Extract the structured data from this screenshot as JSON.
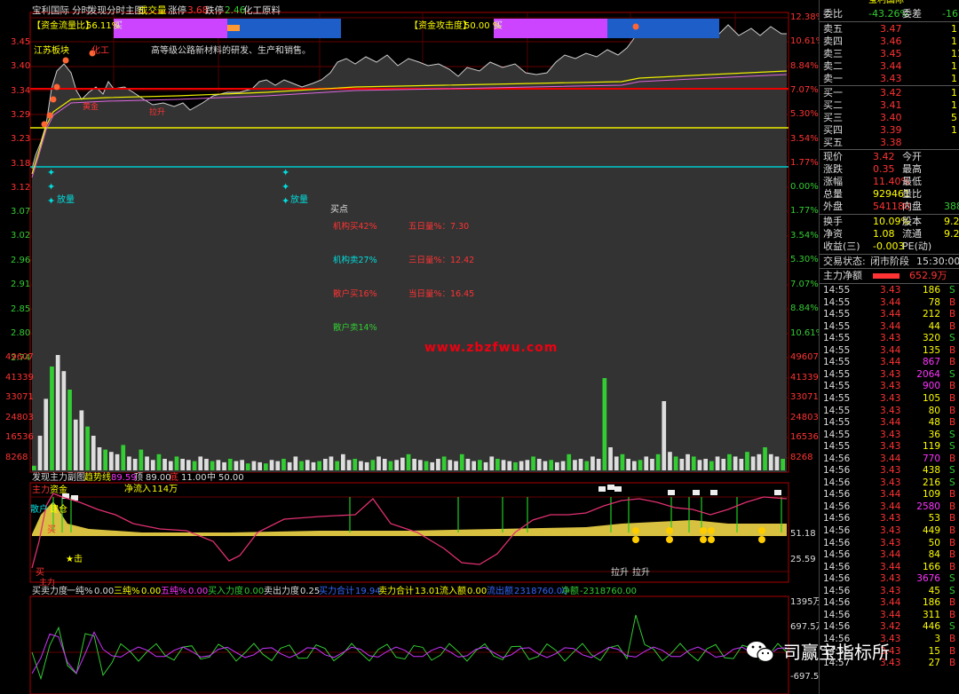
{
  "header": {
    "stock_name": "宝利国际",
    "mode": "分时",
    "indicator": "发现分时主图",
    "volume_label": "成交量",
    "limit_up_label": "涨停",
    "limit_up_value": "3.68",
    "limit_down_label": "跌停",
    "limit_down_value": "2.46",
    "sector": "化工原料"
  },
  "flow_bars": {
    "left_label": "【资金流量比】",
    "left_value": "56.11%",
    "left_tag": "买",
    "right_label": "【资金攻击度】",
    "right_value": "50.00 %",
    "right_tag": "买"
  },
  "annotations": {
    "region": "江苏板块",
    "sector_tag": "化工",
    "business": "高等级公路新材料的研发、生产和销售。",
    "volume_up_1": "放量",
    "volume_up_2": "放量",
    "buy_point": "买点",
    "inst_buy": "机构买42%",
    "inst_sell": "机构卖27%",
    "retail_buy": "散户买16%",
    "retail_sell": "散户卖14%",
    "five_day_vol": "五日量%：7.30",
    "three_day_vol": "三日量%：12.42",
    "today_vol": "当日量%：16.45",
    "small_tag_a": "黄金",
    "small_tag_b": "拉升"
  },
  "watermark": "www.zbzfwu.com",
  "price_axis_left": [
    "3.45",
    "3.40",
    "3.34",
    "3.29",
    "3.23",
    "3.18",
    "3.12",
    "3.07",
    "3.02",
    "2.96",
    "2.91",
    "2.85",
    "2.80",
    "2.74"
  ],
  "price_axis_right": [
    "12.38%",
    "10.61%",
    "8.84%",
    "7.07%",
    "5.30%",
    "3.54%",
    "1.77%",
    "0.00%",
    "1.77%",
    "3.54%",
    "5.30%",
    "7.07%",
    "8.84%",
    "10.61%"
  ],
  "volume_axis": [
    "49607",
    "41339",
    "33071",
    "24803",
    "16536",
    "8268"
  ],
  "sub1": {
    "title": "发现主力副图",
    "trend_label": "趋势线",
    "trend_value": "89.59",
    "top_label": "顶",
    "top_value": "89.00",
    "bottom_label": "底",
    "bottom_value": "11.00",
    "mid_label": "中",
    "mid_value": "50.00",
    "main_label": "主力",
    "main_tag": "资金",
    "scatter_label": "散户",
    "scatter_tag": "建仓",
    "net_inflow_label": "净流入",
    "net_inflow_value": "114万",
    "axis_high": "51.18",
    "axis_low": "25.59",
    "strike_label": "★击",
    "buy_tag": "买",
    "buy_tag2": "买",
    "main_power": "主力",
    "pull_1": "拉升",
    "pull_2": "拉升"
  },
  "sub2": {
    "title": "买卖力度",
    "pure_label": "一纯%",
    "pure_value": "0.00",
    "three_label": "三纯%",
    "three_value": "0.00",
    "five_label": "五纯%",
    "five_value": "0.00",
    "buy_force_label": "买入力度",
    "buy_force_value": "0.00",
    "sell_force_label": "卖出力度",
    "sell_force_value": "0.25",
    "buy_total_label": "买力合计",
    "buy_total_value": "19.94",
    "sell_total_label": "卖力合计",
    "sell_total_value": "13.01",
    "inflow_label": "流入额",
    "inflow_value": "0.00",
    "outflow_label": "流出额",
    "outflow_value": "2318760.00",
    "net_label": "净额",
    "net_value": "-2318760.00",
    "axis_top": "1395万",
    "axis_mid": "697.5万",
    "axis_bot": "-697.5万"
  },
  "panel": {
    "code_title": "宝利国际",
    "bid_ratio_label": "委比",
    "bid_ratio_value": "-43.26%",
    "bid_diff_label": "委差",
    "bid_diff_value": "-16",
    "asks": [
      {
        "label": "卖五",
        "price": "3.47",
        "vol": "1"
      },
      {
        "label": "卖四",
        "price": "3.46",
        "vol": "1"
      },
      {
        "label": "卖三",
        "price": "3.45",
        "vol": "11"
      },
      {
        "label": "卖二",
        "price": "3.44",
        "vol": "1"
      },
      {
        "label": "卖一",
        "price": "3.43",
        "vol": "1"
      }
    ],
    "bids": [
      {
        "label": "买一",
        "price": "3.42",
        "vol": "1"
      },
      {
        "label": "买二",
        "price": "3.41",
        "vol": "1"
      },
      {
        "label": "买三",
        "price": "3.40",
        "vol": "5"
      },
      {
        "label": "买四",
        "price": "3.39",
        "vol": "1"
      },
      {
        "label": "买五",
        "price": "3.38",
        "vol": ""
      }
    ],
    "stats": [
      {
        "l1": "现价",
        "v1": "3.42",
        "l2": "今开",
        "v2": ""
      },
      {
        "l1": "涨跌",
        "v1": "0.35",
        "l2": "最高",
        "v2": ""
      },
      {
        "l1": "涨幅",
        "v1": "11.40%",
        "l2": "最低",
        "v2": ""
      },
      {
        "l1": "总量",
        "v1": "929461",
        "l2": "量比",
        "v2": ""
      },
      {
        "l1": "外盘",
        "v1": "541180",
        "l2": "内盘",
        "v2": "388"
      }
    ],
    "stats2": [
      {
        "l1": "换手",
        "v1": "10.09%",
        "l2": "股本",
        "v2": "9.2"
      },
      {
        "l1": "净资",
        "v1": "1.08",
        "l2": "流通",
        "v2": "9.2"
      },
      {
        "l1": "收益(三)",
        "v1": "-0.003",
        "l2": "PE(动)",
        "v2": ""
      }
    ],
    "trade_state_label": "交易状态:",
    "trade_state_value": "闭市阶段",
    "trade_time": "15:30:00",
    "main_net_label": "主力净额",
    "main_net_value": "652.9万",
    "ticks": [
      [
        "14:55",
        "3.43",
        "186",
        "S"
      ],
      [
        "14:55",
        "3.44",
        "78",
        "B"
      ],
      [
        "14:55",
        "3.44",
        "212",
        "B"
      ],
      [
        "14:55",
        "3.44",
        "44",
        "B"
      ],
      [
        "14:55",
        "3.43",
        "320",
        "S"
      ],
      [
        "14:55",
        "3.44",
        "135",
        "B"
      ],
      [
        "14:55",
        "3.44",
        "867",
        "B"
      ],
      [
        "14:55",
        "3.43",
        "2064",
        "S"
      ],
      [
        "14:55",
        "3.43",
        "900",
        "B"
      ],
      [
        "14:55",
        "3.43",
        "105",
        "B"
      ],
      [
        "14:55",
        "3.43",
        "80",
        "B"
      ],
      [
        "14:55",
        "3.44",
        "48",
        "B"
      ],
      [
        "14:55",
        "3.43",
        "36",
        "S"
      ],
      [
        "14:55",
        "3.43",
        "119",
        "S"
      ],
      [
        "14:56",
        "3.44",
        "770",
        "B"
      ],
      [
        "14:56",
        "3.43",
        "438",
        "S"
      ],
      [
        "14:56",
        "3.43",
        "216",
        "S"
      ],
      [
        "14:56",
        "3.44",
        "109",
        "B"
      ],
      [
        "14:56",
        "3.44",
        "2580",
        "B"
      ],
      [
        "14:56",
        "3.43",
        "53",
        "B"
      ],
      [
        "14:56",
        "3.43",
        "449",
        "B"
      ],
      [
        "14:56",
        "3.43",
        "50",
        "B"
      ],
      [
        "14:56",
        "3.44",
        "84",
        "B"
      ],
      [
        "14:56",
        "3.44",
        "166",
        "B"
      ],
      [
        "14:56",
        "3.43",
        "3676",
        "S"
      ],
      [
        "14:56",
        "3.43",
        "45",
        "S"
      ],
      [
        "14:56",
        "3.44",
        "186",
        "B"
      ],
      [
        "14:56",
        "3.44",
        "311",
        "B"
      ],
      [
        "14:56",
        "3.42",
        "446",
        "S"
      ],
      [
        "14:56",
        "3.43",
        "3",
        "B"
      ],
      [
        "14:56",
        "3.43",
        "15",
        "B"
      ],
      [
        "14:57",
        "3.43",
        "27",
        "B"
      ]
    ]
  },
  "logo_text": "司赢宝指标所",
  "colors": {
    "up": "#ff3333",
    "down": "#33cc33",
    "accent": "#ffff00",
    "cyan": "#00dddd",
    "magenta": "#cc33ff",
    "blue": "#1e5ec8"
  }
}
